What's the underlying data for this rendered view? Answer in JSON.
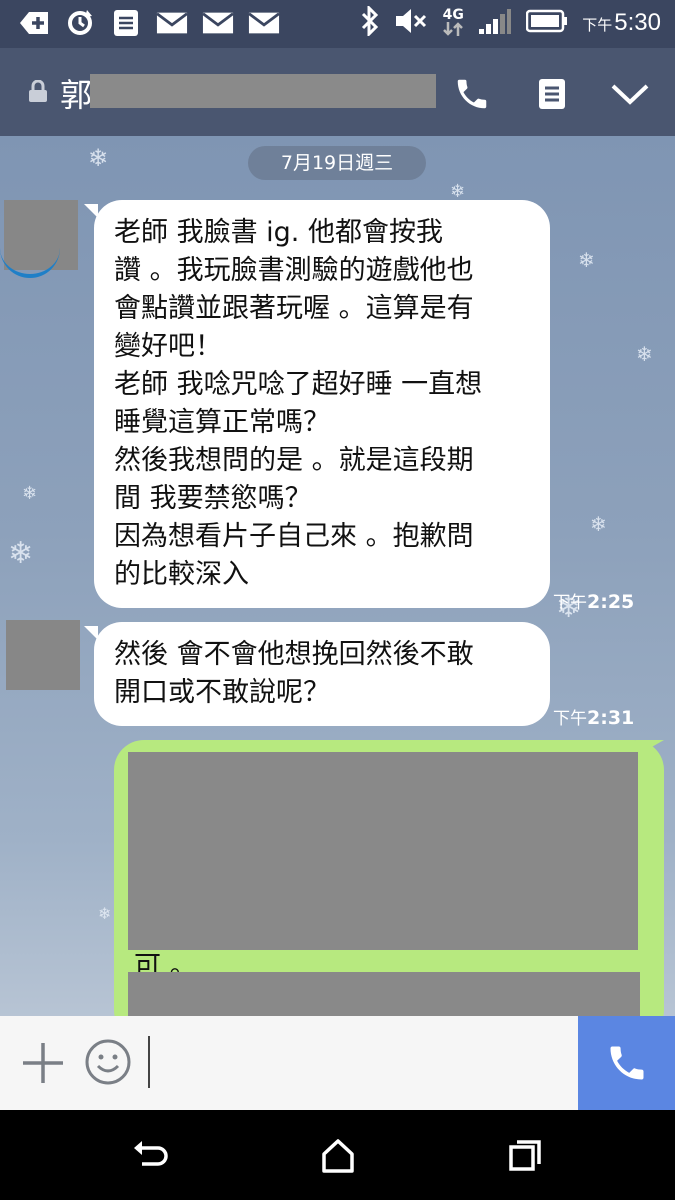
{
  "status_bar": {
    "ampm": "下午",
    "time": "5:30",
    "network": "4G",
    "icons": [
      "add-icon",
      "sync-icon",
      "note-icon",
      "mail-icon",
      "mail-icon",
      "mail-icon",
      "bluetooth-icon",
      "mute-icon",
      "signal-icon",
      "battery-icon"
    ]
  },
  "header": {
    "contact_name_visible": "郭",
    "icons": [
      "lock-icon",
      "phone-icon",
      "memo-icon",
      "chevron-down-icon"
    ]
  },
  "chat": {
    "date_label": "7月19日週三",
    "messages": [
      {
        "sender": "other",
        "text": "老師  我臉書 ig. 他都會按我\n讚 。我玩臉書測驗的遊戲他也\n會點讚並跟著玩喔 。這算是有\n變好吧！\n老師 我唸咒唸了超好睡 一直想\n睡覺這算正常嗎？\n然後我想問的是 。就是這段期\n間 我要禁慾嗎？\n因為想看片子自己來 。抱歉問\n的比較深入",
        "time_ampm": "下午",
        "time": "2:25"
      },
      {
        "sender": "other",
        "text": "然後 會不會他想挽回然後不敢\n開口或不敢說呢？",
        "time_ampm": "下午",
        "time": "2:31"
      },
      {
        "sender": "me",
        "visible_text": "可 。"
      }
    ]
  },
  "input_bar": {
    "placeholder": "",
    "icons": [
      "plus-icon",
      "emoji-icon",
      "phone-icon"
    ]
  },
  "nav_bar": {
    "icons": [
      "back-icon",
      "home-icon",
      "recents-icon"
    ]
  },
  "colors": {
    "status_bar": "#3b4660",
    "header": "#4a5670",
    "my_bubble": "#b7e97f",
    "call_button": "#5b86e2"
  }
}
